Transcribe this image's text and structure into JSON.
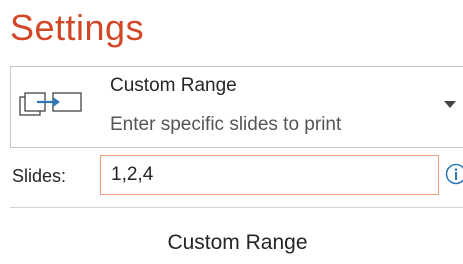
{
  "settings": {
    "heading": "Settings",
    "range_dropdown": {
      "title": "Custom Range",
      "description": "Enter specific slides to print",
      "icon": "custom-range-icon"
    },
    "slides": {
      "label": "Slides:",
      "value": "1,2,4"
    },
    "caption": "Custom Range"
  },
  "colors": {
    "heading": "#d24726",
    "input_border": "#f0a07e",
    "info_icon": "#2e75b6",
    "icon_arrow": "#2e75b6"
  }
}
